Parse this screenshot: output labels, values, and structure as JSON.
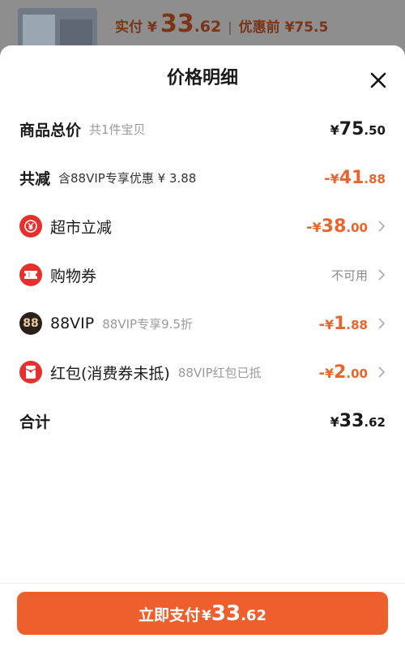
{
  "background": {
    "pay_label": "实付",
    "pay_yen": "¥",
    "pay_int": "33",
    "pay_dec": ".62",
    "separator": "|",
    "orig_label": "优惠前 ¥75.5"
  },
  "sheet": {
    "title": "价格明细",
    "close_icon": "close-icon"
  },
  "rows": {
    "total": {
      "label": "商品总价",
      "sub": "共1件宝贝",
      "yen": "¥",
      "int": "75",
      "dec": ".50"
    },
    "reduce": {
      "label": "共减",
      "sub": "含88VIP专享优惠 ¥ 3.88",
      "sign": "-",
      "yen": "¥",
      "int": "41",
      "dec": ".88"
    },
    "supermarket": {
      "icon": "supermarket-discount-icon",
      "label": "超市立减",
      "sign": "-",
      "yen": "¥",
      "int": "38",
      "dec": ".00"
    },
    "coupon": {
      "icon": "coupon-icon",
      "label": "购物券",
      "status": "不可用"
    },
    "vip": {
      "icon": "88vip-icon",
      "icon_text": "88",
      "label": "88VIP",
      "sub": "88VIP专享9.5折",
      "sign": "-",
      "yen": "¥",
      "int": "1",
      "dec": ".88"
    },
    "redpacket": {
      "icon": "red-packet-icon",
      "label": "红包(消费券未抵)",
      "sub": "88VIP红包已抵",
      "sign": "-",
      "yen": "¥",
      "int": "2",
      "dec": ".00"
    },
    "sum": {
      "label": "合计",
      "yen": "¥",
      "int": "33",
      "dec": ".62"
    }
  },
  "pay_button": {
    "label": "立即支付",
    "yen": "¥",
    "int": "33",
    "dec": ".62"
  },
  "colors": {
    "accent": "#ee5f2e",
    "discount": "#e8652e",
    "icon_red": "#e5302e"
  }
}
